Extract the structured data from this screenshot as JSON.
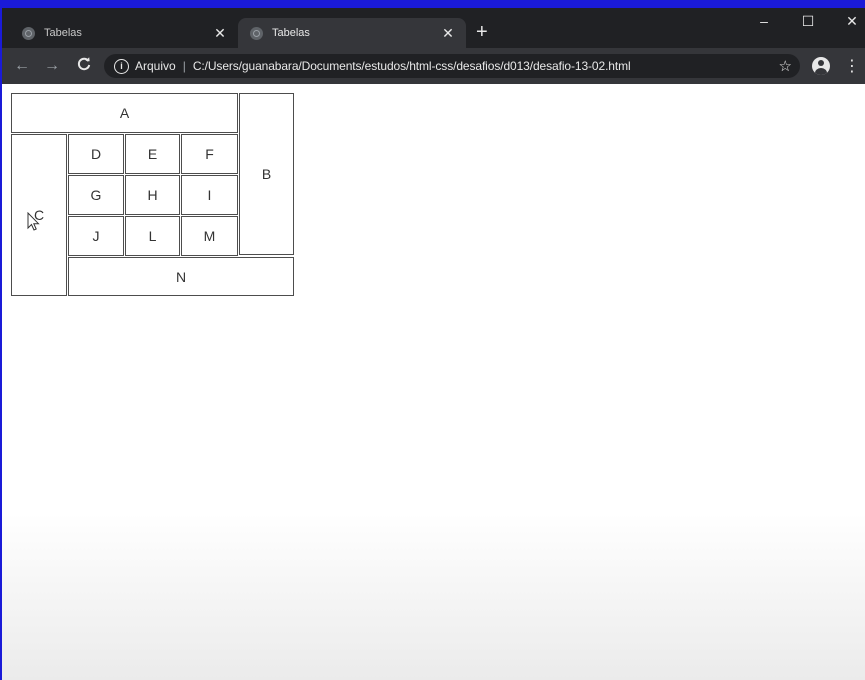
{
  "browser": {
    "tabs": [
      {
        "title": "Tabelas",
        "close": "✕"
      },
      {
        "title": "Tabelas",
        "close": "✕"
      }
    ],
    "new_tab": "+",
    "window_controls": {
      "minimize": "–",
      "maximize": "☐",
      "close": "✕"
    },
    "nav": {
      "back": "←",
      "forward": "→",
      "reload": "C"
    },
    "address": {
      "info_icon": "i",
      "scheme_label": "Arquivo",
      "separator": "|",
      "url": "C:/Users/guanabara/Documents/estudos/html-css/desafios/d013/desafio-13-02.html",
      "star": "☆"
    },
    "menu": "⋮"
  },
  "page": {
    "cells": {
      "A": "A",
      "B": "B",
      "C": "C",
      "D": "D",
      "E": "E",
      "F": "F",
      "G": "G",
      "H": "H",
      "I": "I",
      "J": "J",
      "L": "L",
      "M": "M",
      "N": "N"
    }
  }
}
